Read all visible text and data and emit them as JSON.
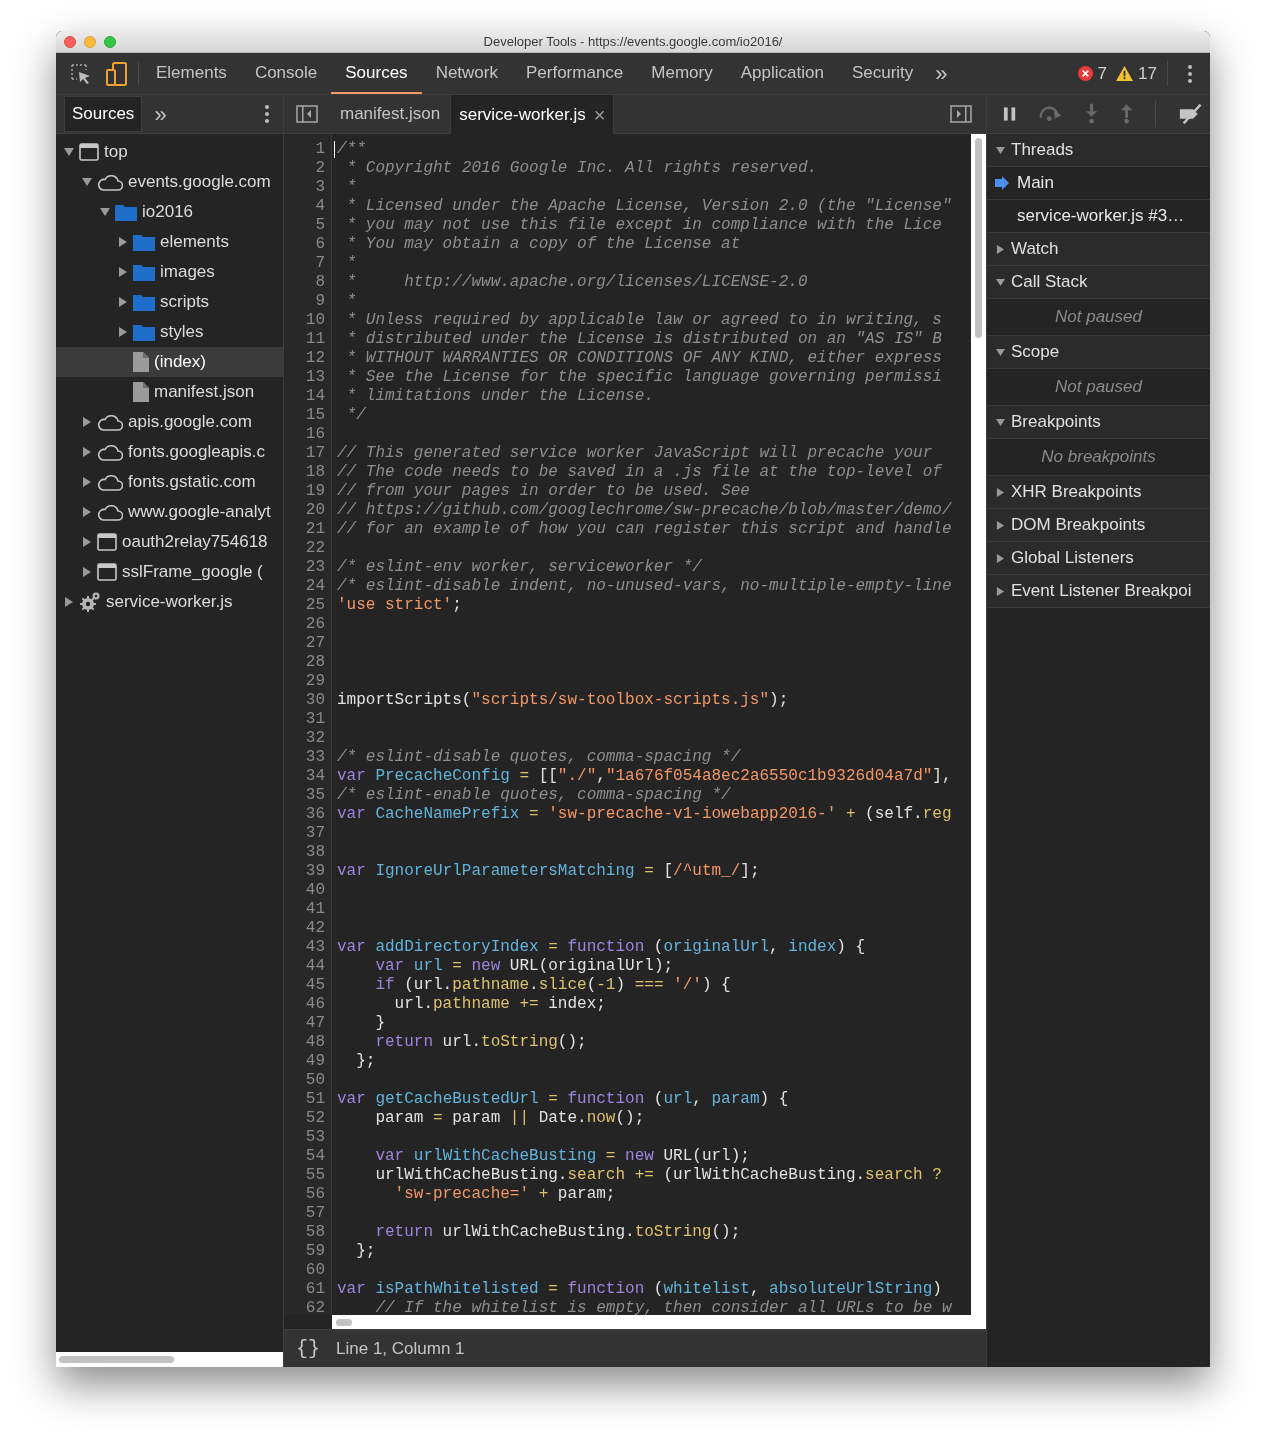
{
  "window": {
    "title": "Developer Tools - https://events.google.com/io2016/"
  },
  "main_tabs": [
    {
      "label": "Elements",
      "selected": false
    },
    {
      "label": "Console",
      "selected": false
    },
    {
      "label": "Sources",
      "selected": true
    },
    {
      "label": "Network",
      "selected": false
    },
    {
      "label": "Performance",
      "selected": false
    },
    {
      "label": "Memory",
      "selected": false
    },
    {
      "label": "Application",
      "selected": false
    },
    {
      "label": "Security",
      "selected": false
    }
  ],
  "more_tabs": "»",
  "issues": {
    "errors": "7",
    "warnings": "17"
  },
  "navigator": {
    "tabs": [
      {
        "label": "Sources",
        "selected": true
      }
    ],
    "more": "»",
    "tree": [
      {
        "label": "top",
        "kind": "frame",
        "expanded": true,
        "selected": false,
        "children": [
          {
            "label": "events.google.com",
            "kind": "domain",
            "expanded": true,
            "selected": false,
            "children": [
              {
                "label": "io2016",
                "kind": "folder",
                "expanded": true,
                "selected": false,
                "children": [
                  {
                    "label": "elements",
                    "kind": "folder",
                    "expanded": false,
                    "selected": false
                  },
                  {
                    "label": "images",
                    "kind": "folder",
                    "expanded": false,
                    "selected": false
                  },
                  {
                    "label": "scripts",
                    "kind": "folder",
                    "expanded": false,
                    "selected": false
                  },
                  {
                    "label": "styles",
                    "kind": "folder",
                    "expanded": false,
                    "selected": false
                  },
                  {
                    "label": "(index)",
                    "kind": "file",
                    "selected": true
                  },
                  {
                    "label": "manifest.json",
                    "kind": "file",
                    "selected": false
                  }
                ]
              }
            ]
          },
          {
            "label": "apis.google.com",
            "kind": "domain",
            "expanded": false,
            "selected": false
          },
          {
            "label": "fonts.googleapis.c",
            "kind": "domain",
            "expanded": false,
            "selected": false
          },
          {
            "label": "fonts.gstatic.com",
            "kind": "domain",
            "expanded": false,
            "selected": false
          },
          {
            "label": "www.google-analyt",
            "kind": "domain",
            "expanded": false,
            "selected": false
          },
          {
            "label": "oauth2relay754618",
            "kind": "frame",
            "expanded": false,
            "selected": false
          },
          {
            "label": "sslFrame_google (",
            "kind": "frame",
            "expanded": false,
            "selected": false
          }
        ]
      },
      {
        "label": "service-worker.js",
        "kind": "gear",
        "expanded": false,
        "selected": false
      }
    ]
  },
  "editor": {
    "tabs": [
      {
        "label": "manifest.json",
        "selected": false,
        "closable": false
      },
      {
        "label": "service-worker.js",
        "selected": true,
        "closable": true
      }
    ],
    "close_glyph": "×",
    "lines": [
      {
        "number": "1",
        "tokens": [
          {
            "kind": "comment",
            "text": "/**"
          }
        ]
      },
      {
        "number": "2",
        "tokens": [
          {
            "kind": "comment",
            "text": " * Copyright 2016 Google Inc. All rights reserved."
          }
        ]
      },
      {
        "number": "3",
        "tokens": [
          {
            "kind": "comment",
            "text": " *"
          }
        ]
      },
      {
        "number": "4",
        "tokens": [
          {
            "kind": "comment",
            "text": " * Licensed under the Apache License, Version 2.0 (the \"License\""
          }
        ]
      },
      {
        "number": "5",
        "tokens": [
          {
            "kind": "comment",
            "text": " * you may not use this file except in compliance with the Lice"
          }
        ]
      },
      {
        "number": "6",
        "tokens": [
          {
            "kind": "comment",
            "text": " * You may obtain a copy of the License at"
          }
        ]
      },
      {
        "number": "7",
        "tokens": [
          {
            "kind": "comment",
            "text": " *"
          }
        ]
      },
      {
        "number": "8",
        "tokens": [
          {
            "kind": "comment",
            "text": " *     http://www.apache.org/licenses/LICENSE-2.0"
          }
        ]
      },
      {
        "number": "9",
        "tokens": [
          {
            "kind": "comment",
            "text": " *"
          }
        ]
      },
      {
        "number": "10",
        "tokens": [
          {
            "kind": "comment",
            "text": " * Unless required by applicable law or agreed to in writing, s"
          }
        ]
      },
      {
        "number": "11",
        "tokens": [
          {
            "kind": "comment",
            "text": " * distributed under the License is distributed on an \"AS IS\" B"
          }
        ]
      },
      {
        "number": "12",
        "tokens": [
          {
            "kind": "comment",
            "text": " * WITHOUT WARRANTIES OR CONDITIONS OF ANY KIND, either express"
          }
        ]
      },
      {
        "number": "13",
        "tokens": [
          {
            "kind": "comment",
            "text": " * See the License for the specific language governing permissi"
          }
        ]
      },
      {
        "number": "14",
        "tokens": [
          {
            "kind": "comment",
            "text": " * limitations under the License."
          }
        ]
      },
      {
        "number": "15",
        "tokens": [
          {
            "kind": "comment",
            "text": " */"
          }
        ]
      },
      {
        "number": "16"
      },
      {
        "number": "17",
        "tokens": [
          {
            "kind": "comment",
            "text": "// This generated service worker JavaScript will precache your"
          }
        ]
      },
      {
        "number": "18",
        "tokens": [
          {
            "kind": "comment",
            "text": "// The code needs to be saved in a .js file at the top-level of"
          }
        ]
      },
      {
        "number": "19",
        "tokens": [
          {
            "kind": "comment",
            "text": "// from your pages in order to be used. See"
          }
        ]
      },
      {
        "number": "20",
        "tokens": [
          {
            "kind": "comment",
            "text": "// https://github.com/googlechrome/sw-precache/blob/master/demo/"
          }
        ]
      },
      {
        "number": "21",
        "tokens": [
          {
            "kind": "comment",
            "text": "// for an example of how you can register this script and handle"
          }
        ]
      },
      {
        "number": "22"
      },
      {
        "number": "23",
        "tokens": [
          {
            "kind": "comment",
            "text": "/* eslint-env worker, serviceworker */"
          }
        ]
      },
      {
        "number": "24",
        "tokens": [
          {
            "kind": "comment",
            "text": "/* eslint-disable indent, no-unused-vars, no-multiple-empty-line"
          }
        ]
      },
      {
        "number": "25",
        "tokens": [
          {
            "kind": "string",
            "text": "'use strict'"
          },
          {
            "kind": "plain",
            "text": ";"
          }
        ]
      },
      {
        "number": "26"
      },
      {
        "number": "27"
      },
      {
        "number": "28"
      },
      {
        "number": "29"
      },
      {
        "number": "30",
        "tokens": [
          {
            "kind": "plain",
            "text": "importScripts("
          },
          {
            "kind": "string",
            "text": "\"scripts/sw-toolbox-scripts.js\""
          },
          {
            "kind": "plain",
            "text": ");"
          }
        ]
      },
      {
        "number": "31"
      },
      {
        "number": "32"
      },
      {
        "number": "33",
        "tokens": [
          {
            "kind": "comment",
            "text": "/* eslint-disable quotes, comma-spacing */"
          }
        ]
      },
      {
        "number": "34",
        "tokens": [
          {
            "kind": "keyword",
            "text": "var"
          },
          {
            "kind": "def",
            "text": " PrecacheConfig"
          },
          {
            "kind": "op",
            "text": " = "
          },
          {
            "kind": "plain",
            "text": "[["
          },
          {
            "kind": "string",
            "text": "\"./\""
          },
          {
            "kind": "plain",
            "text": ","
          },
          {
            "kind": "string",
            "text": "\"1a676f054a8ec2a6550c1b9326d04a7d\""
          },
          {
            "kind": "plain",
            "text": "],"
          }
        ]
      },
      {
        "number": "35",
        "tokens": [
          {
            "kind": "comment",
            "text": "/* eslint-enable quotes, comma-spacing */"
          }
        ]
      },
      {
        "number": "36",
        "tokens": [
          {
            "kind": "keyword",
            "text": "var"
          },
          {
            "kind": "def",
            "text": " CacheNamePrefix"
          },
          {
            "kind": "op",
            "text": " = "
          },
          {
            "kind": "string",
            "text": "'sw-precache-v1-iowebapp2016-'"
          },
          {
            "kind": "op",
            "text": " + "
          },
          {
            "kind": "plain",
            "text": "(self."
          },
          {
            "kind": "prop",
            "text": "reg"
          }
        ]
      },
      {
        "number": "37"
      },
      {
        "number": "38"
      },
      {
        "number": "39",
        "tokens": [
          {
            "kind": "keyword",
            "text": "var"
          },
          {
            "kind": "def",
            "text": " IgnoreUrlParametersMatching"
          },
          {
            "kind": "op",
            "text": " = "
          },
          {
            "kind": "plain",
            "text": "["
          },
          {
            "kind": "string",
            "text": "/^utm_/"
          },
          {
            "kind": "plain",
            "text": "];"
          }
        ]
      },
      {
        "number": "40"
      },
      {
        "number": "41"
      },
      {
        "number": "42"
      },
      {
        "number": "43",
        "tokens": [
          {
            "kind": "keyword",
            "text": "var"
          },
          {
            "kind": "def",
            "text": " addDirectoryIndex"
          },
          {
            "kind": "op",
            "text": " = "
          },
          {
            "kind": "keyword",
            "text": "function"
          },
          {
            "kind": "plain",
            "text": " ("
          },
          {
            "kind": "def",
            "text": "originalUrl"
          },
          {
            "kind": "plain",
            "text": ", "
          },
          {
            "kind": "def",
            "text": "index"
          },
          {
            "kind": "plain",
            "text": ") {"
          }
        ]
      },
      {
        "number": "44",
        "tokens": [
          {
            "kind": "keyword",
            "text": "    var"
          },
          {
            "kind": "def",
            "text": " url"
          },
          {
            "kind": "op",
            "text": " = "
          },
          {
            "kind": "keyword",
            "text": "new"
          },
          {
            "kind": "plain",
            "text": " URL(originalUrl);"
          }
        ]
      },
      {
        "number": "45",
        "tokens": [
          {
            "kind": "keyword",
            "text": "    if"
          },
          {
            "kind": "plain",
            "text": " (url."
          },
          {
            "kind": "prop",
            "text": "pathname"
          },
          {
            "kind": "plain",
            "text": "."
          },
          {
            "kind": "prop",
            "text": "slice"
          },
          {
            "kind": "plain",
            "text": "("
          },
          {
            "kind": "op",
            "text": "-1"
          },
          {
            "kind": "plain",
            "text": ") "
          },
          {
            "kind": "op",
            "text": "==="
          },
          {
            "kind": "string",
            "text": " '/'"
          },
          {
            "kind": "plain",
            "text": ") {"
          }
        ]
      },
      {
        "number": "46",
        "tokens": [
          {
            "kind": "plain",
            "text": "      url."
          },
          {
            "kind": "prop",
            "text": "pathname"
          },
          {
            "kind": "op",
            "text": " += "
          },
          {
            "kind": "plain",
            "text": "index;"
          }
        ]
      },
      {
        "number": "47",
        "tokens": [
          {
            "kind": "plain",
            "text": "    }"
          }
        ]
      },
      {
        "number": "48",
        "tokens": [
          {
            "kind": "keyword",
            "text": "    return"
          },
          {
            "kind": "plain",
            "text": " url."
          },
          {
            "kind": "prop",
            "text": "toString"
          },
          {
            "kind": "plain",
            "text": "();"
          }
        ]
      },
      {
        "number": "49",
        "tokens": [
          {
            "kind": "plain",
            "text": "  };"
          }
        ]
      },
      {
        "number": "50"
      },
      {
        "number": "51",
        "tokens": [
          {
            "kind": "keyword",
            "text": "var"
          },
          {
            "kind": "def",
            "text": " getCacheBustedUrl"
          },
          {
            "kind": "op",
            "text": " = "
          },
          {
            "kind": "keyword",
            "text": "function"
          },
          {
            "kind": "plain",
            "text": " ("
          },
          {
            "kind": "def",
            "text": "url"
          },
          {
            "kind": "plain",
            "text": ", "
          },
          {
            "kind": "def",
            "text": "param"
          },
          {
            "kind": "plain",
            "text": ") {"
          }
        ]
      },
      {
        "number": "52",
        "tokens": [
          {
            "kind": "plain",
            "text": "    param "
          },
          {
            "kind": "op",
            "text": "="
          },
          {
            "kind": "plain",
            "text": " param "
          },
          {
            "kind": "op",
            "text": "||"
          },
          {
            "kind": "plain",
            "text": " Date."
          },
          {
            "kind": "prop",
            "text": "now"
          },
          {
            "kind": "plain",
            "text": "();"
          }
        ]
      },
      {
        "number": "53"
      },
      {
        "number": "54",
        "tokens": [
          {
            "kind": "keyword",
            "text": "    var"
          },
          {
            "kind": "def",
            "text": " urlWithCacheBusting"
          },
          {
            "kind": "op",
            "text": " = "
          },
          {
            "kind": "keyword",
            "text": "new"
          },
          {
            "kind": "plain",
            "text": " URL(url);"
          }
        ]
      },
      {
        "number": "55",
        "tokens": [
          {
            "kind": "plain",
            "text": "    urlWithCacheBusting."
          },
          {
            "kind": "prop",
            "text": "search"
          },
          {
            "kind": "op",
            "text": " += "
          },
          {
            "kind": "plain",
            "text": "(urlWithCacheBusting."
          },
          {
            "kind": "prop",
            "text": "search"
          },
          {
            "kind": "op",
            "text": " ?"
          }
        ]
      },
      {
        "number": "56",
        "tokens": [
          {
            "kind": "string",
            "text": "      'sw-precache='"
          },
          {
            "kind": "op",
            "text": " + "
          },
          {
            "kind": "plain",
            "text": "param;"
          }
        ]
      },
      {
        "number": "57"
      },
      {
        "number": "58",
        "tokens": [
          {
            "kind": "keyword",
            "text": "    return"
          },
          {
            "kind": "plain",
            "text": " urlWithCacheBusting."
          },
          {
            "kind": "prop",
            "text": "toString"
          },
          {
            "kind": "plain",
            "text": "();"
          }
        ]
      },
      {
        "number": "59",
        "tokens": [
          {
            "kind": "plain",
            "text": "  };"
          }
        ]
      },
      {
        "number": "60"
      },
      {
        "number": "61",
        "tokens": [
          {
            "kind": "keyword",
            "text": "var"
          },
          {
            "kind": "def",
            "text": " isPathWhitelisted"
          },
          {
            "kind": "op",
            "text": " = "
          },
          {
            "kind": "keyword",
            "text": "function"
          },
          {
            "kind": "plain",
            "text": " ("
          },
          {
            "kind": "def",
            "text": "whitelist"
          },
          {
            "kind": "plain",
            "text": ", "
          },
          {
            "kind": "def",
            "text": "absoluteUrlString"
          },
          {
            "kind": "plain",
            "text": ")"
          }
        ]
      },
      {
        "number": "62",
        "tokens": [
          {
            "kind": "comment",
            "text": "    // If the whitelist is empty, then consider all URLs to be w"
          }
        ]
      }
    ],
    "status": {
      "format": "{}",
      "position": "Line 1, Column 1"
    }
  },
  "debugger": {
    "sections": [
      {
        "kind": "header",
        "label": "Threads",
        "expanded": true
      },
      {
        "kind": "thread",
        "label": "Main",
        "current": true
      },
      {
        "kind": "thread",
        "label": "service-worker.js #3…",
        "current": false
      },
      {
        "kind": "header",
        "label": "Watch",
        "expanded": false
      },
      {
        "kind": "header",
        "label": "Call Stack",
        "expanded": true
      },
      {
        "kind": "empty",
        "label": "Not paused"
      },
      {
        "kind": "header",
        "label": "Scope",
        "expanded": true
      },
      {
        "kind": "empty",
        "label": "Not paused"
      },
      {
        "kind": "header",
        "label": "Breakpoints",
        "expanded": true
      },
      {
        "kind": "empty",
        "label": "No breakpoints"
      },
      {
        "kind": "header",
        "label": "XHR Breakpoints",
        "expanded": false
      },
      {
        "kind": "header",
        "label": "DOM Breakpoints",
        "expanded": false
      },
      {
        "kind": "header",
        "label": "Global Listeners",
        "expanded": false
      },
      {
        "kind": "header",
        "label": "Event Listener Breakpoi",
        "expanded": false
      }
    ]
  }
}
